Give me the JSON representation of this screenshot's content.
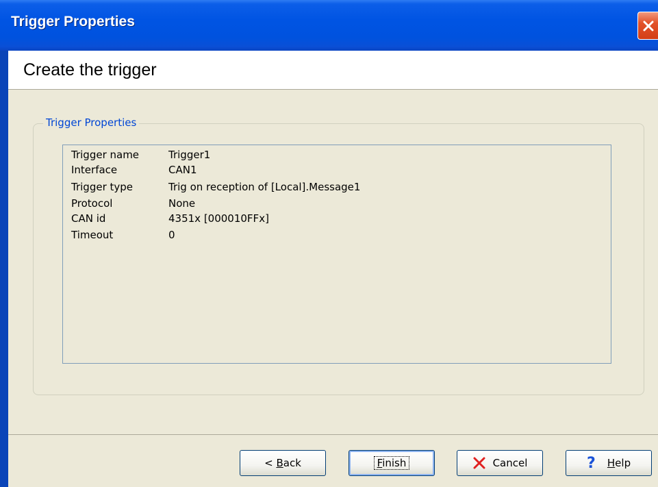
{
  "window": {
    "title": "Trigger Properties"
  },
  "header": {
    "heading": "Create the trigger"
  },
  "group": {
    "legend": "Trigger Properties",
    "rows": [
      {
        "label": "Trigger name",
        "value": "Trigger1"
      },
      {
        "label": "Interface",
        "value": "CAN1"
      },
      {
        "label": "Trigger type",
        "value": "Trig on reception of [Local].Message1"
      },
      {
        "label": "Protocol",
        "value": "None"
      },
      {
        "label": "CAN id",
        "value": "4351x [000010FFx]"
      },
      {
        "label": "Timeout",
        "value": "0"
      }
    ]
  },
  "buttons": {
    "back": {
      "pre": "< ",
      "accel": "B",
      "post": "ack"
    },
    "finish": {
      "accel": "F",
      "post": "inish"
    },
    "cancel": {
      "label": "Cancel"
    },
    "help": {
      "accel": "H",
      "post": "elp"
    }
  },
  "icons": {
    "close": "close-icon",
    "cancel": "x-icon",
    "help": "question-mark-icon"
  },
  "colors": {
    "titlebar": "#0054e3",
    "legend": "#0046d5",
    "cancel_icon": "#e02020",
    "help_icon": "#1a52d8"
  }
}
